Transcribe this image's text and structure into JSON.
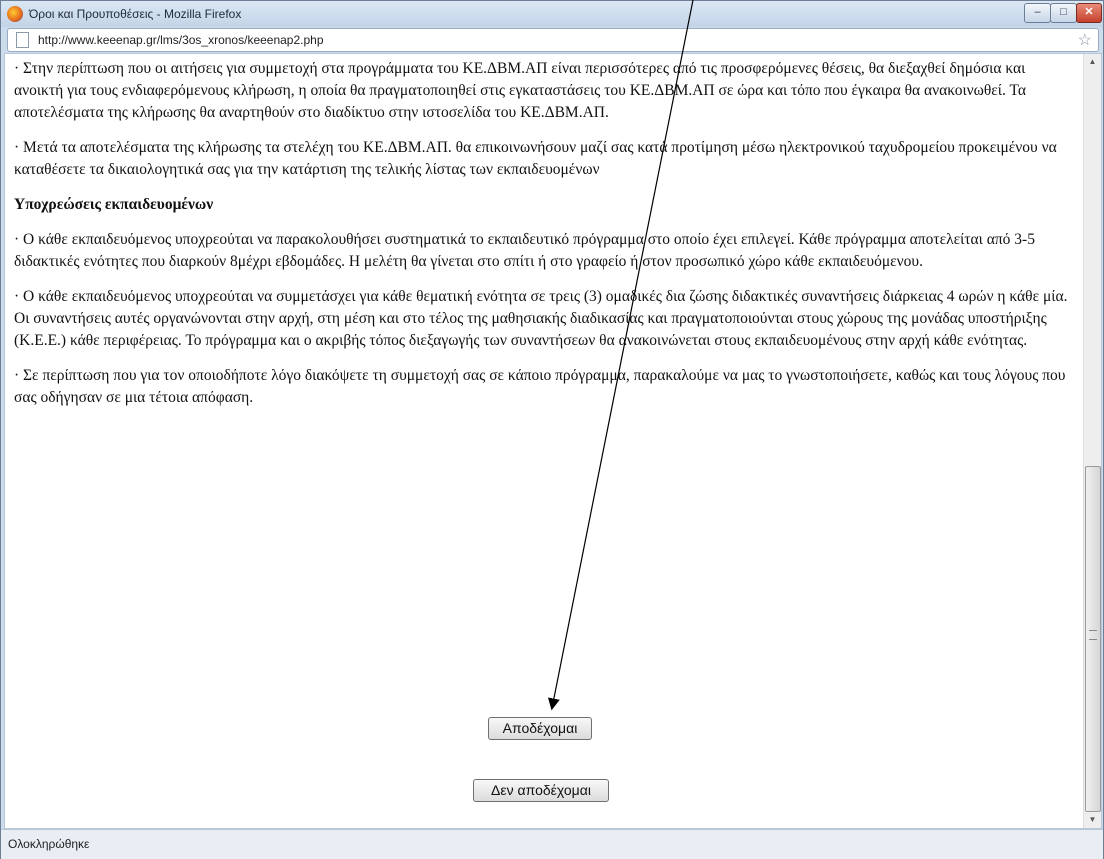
{
  "window": {
    "title": "Όροι και Προυποθέσεις - Mozilla Firefox",
    "min_label": "–",
    "max_label": "□",
    "close_label": "✕"
  },
  "address": {
    "url": "http://www.keeenap.gr/lms/3os_xronos/keeenap2.php"
  },
  "content": {
    "paragraphs_top": [
      "· Στην περίπτωση που οι αιτήσεις για συμμετοχή στα προγράμματα του ΚΕ.ΔΒΜ.ΑΠ είναι περισσότερες από τις προσφερόμενες θέσεις, θα διεξαχθεί δημόσια και ανοικτή για τους ενδιαφερόμενους κλήρωση, η οποία θα πραγματοποιηθεί στις εγκαταστάσεις του ΚΕ.ΔΒΜ.ΑΠ σε ώρα και τόπο που έγκαιρα θα ανακοινωθεί. Τα αποτελέσματα της κλήρωσης θα αναρτηθούν στο διαδίκτυο στην ιστοσελίδα του ΚΕ.ΔΒΜ.ΑΠ.",
      "· Μετά τα αποτελέσματα της κλήρωσης τα στελέχη του ΚΕ.ΔΒΜ.ΑΠ. θα επικοινωνήσουν μαζί σας κατά προτίμηση μέσω ηλεκτρονικού ταχυδρομείου προκειμένου να καταθέσετε τα δικαιολογητικά σας για την κατάρτιση της τελικής λίστας των εκπαιδευομένων"
    ],
    "heading": "Υποχρεώσεις εκπαιδευομένων",
    "paragraphs_bottom": [
      "· Ο κάθε εκπαιδευόμενος υποχρεούται να παρακολουθήσει συστηματικά το εκπαιδευτικό πρόγραμμα στο οποίο έχει επιλεγεί. Κάθε πρόγραμμα αποτελείται από 3-5 διδακτικές ενότητες που διαρκούν 8μέχρι εβδομάδες. Η μελέτη θα γίνεται στο σπίτι ή στο γραφείο ή στον προσωπικό χώρο κάθε εκπαιδευόμενου.",
      "· Ο κάθε εκπαιδευόμενος υποχρεούται να συμμετάσχει για κάθε θεματική ενότητα σε τρεις (3) ομαδικές δια ζώσης διδακτικές συναντήσεις διάρκειας 4 ωρών η κάθε μία. Οι συναντήσεις αυτές οργανώνονται στην αρχή, στη μέση και στο τέλος της μαθησιακής διαδικασίας και πραγματοποιούνται στους χώρους της μονάδας υποστήριξης (Κ.Ε.Ε.) κάθε περιφέρειας. Το πρόγραμμα και ο ακριβής τόπος διεξαγωγής των συναντήσεων θα ανακοινώνεται στους εκπαιδευομένους στην αρχή κάθε ενότητας.",
      "· Σε περίπτωση που για τον οποιοδήποτε λόγο διακόψετε τη συμμετοχή σας σε κάποιο πρόγραμμα, παρακαλούμε να μας το γνωστοποιήσετε, καθώς και τους λόγους που σας οδήγησαν σε μια τέτοια απόφαση."
    ],
    "accept_label": "Αποδέχομαι",
    "decline_label": "Δεν αποδέχομαι"
  },
  "scrollbar": {
    "up_label": "▲",
    "down_label": "▼"
  },
  "status": {
    "text": "Ολοκληρώθηκε"
  }
}
